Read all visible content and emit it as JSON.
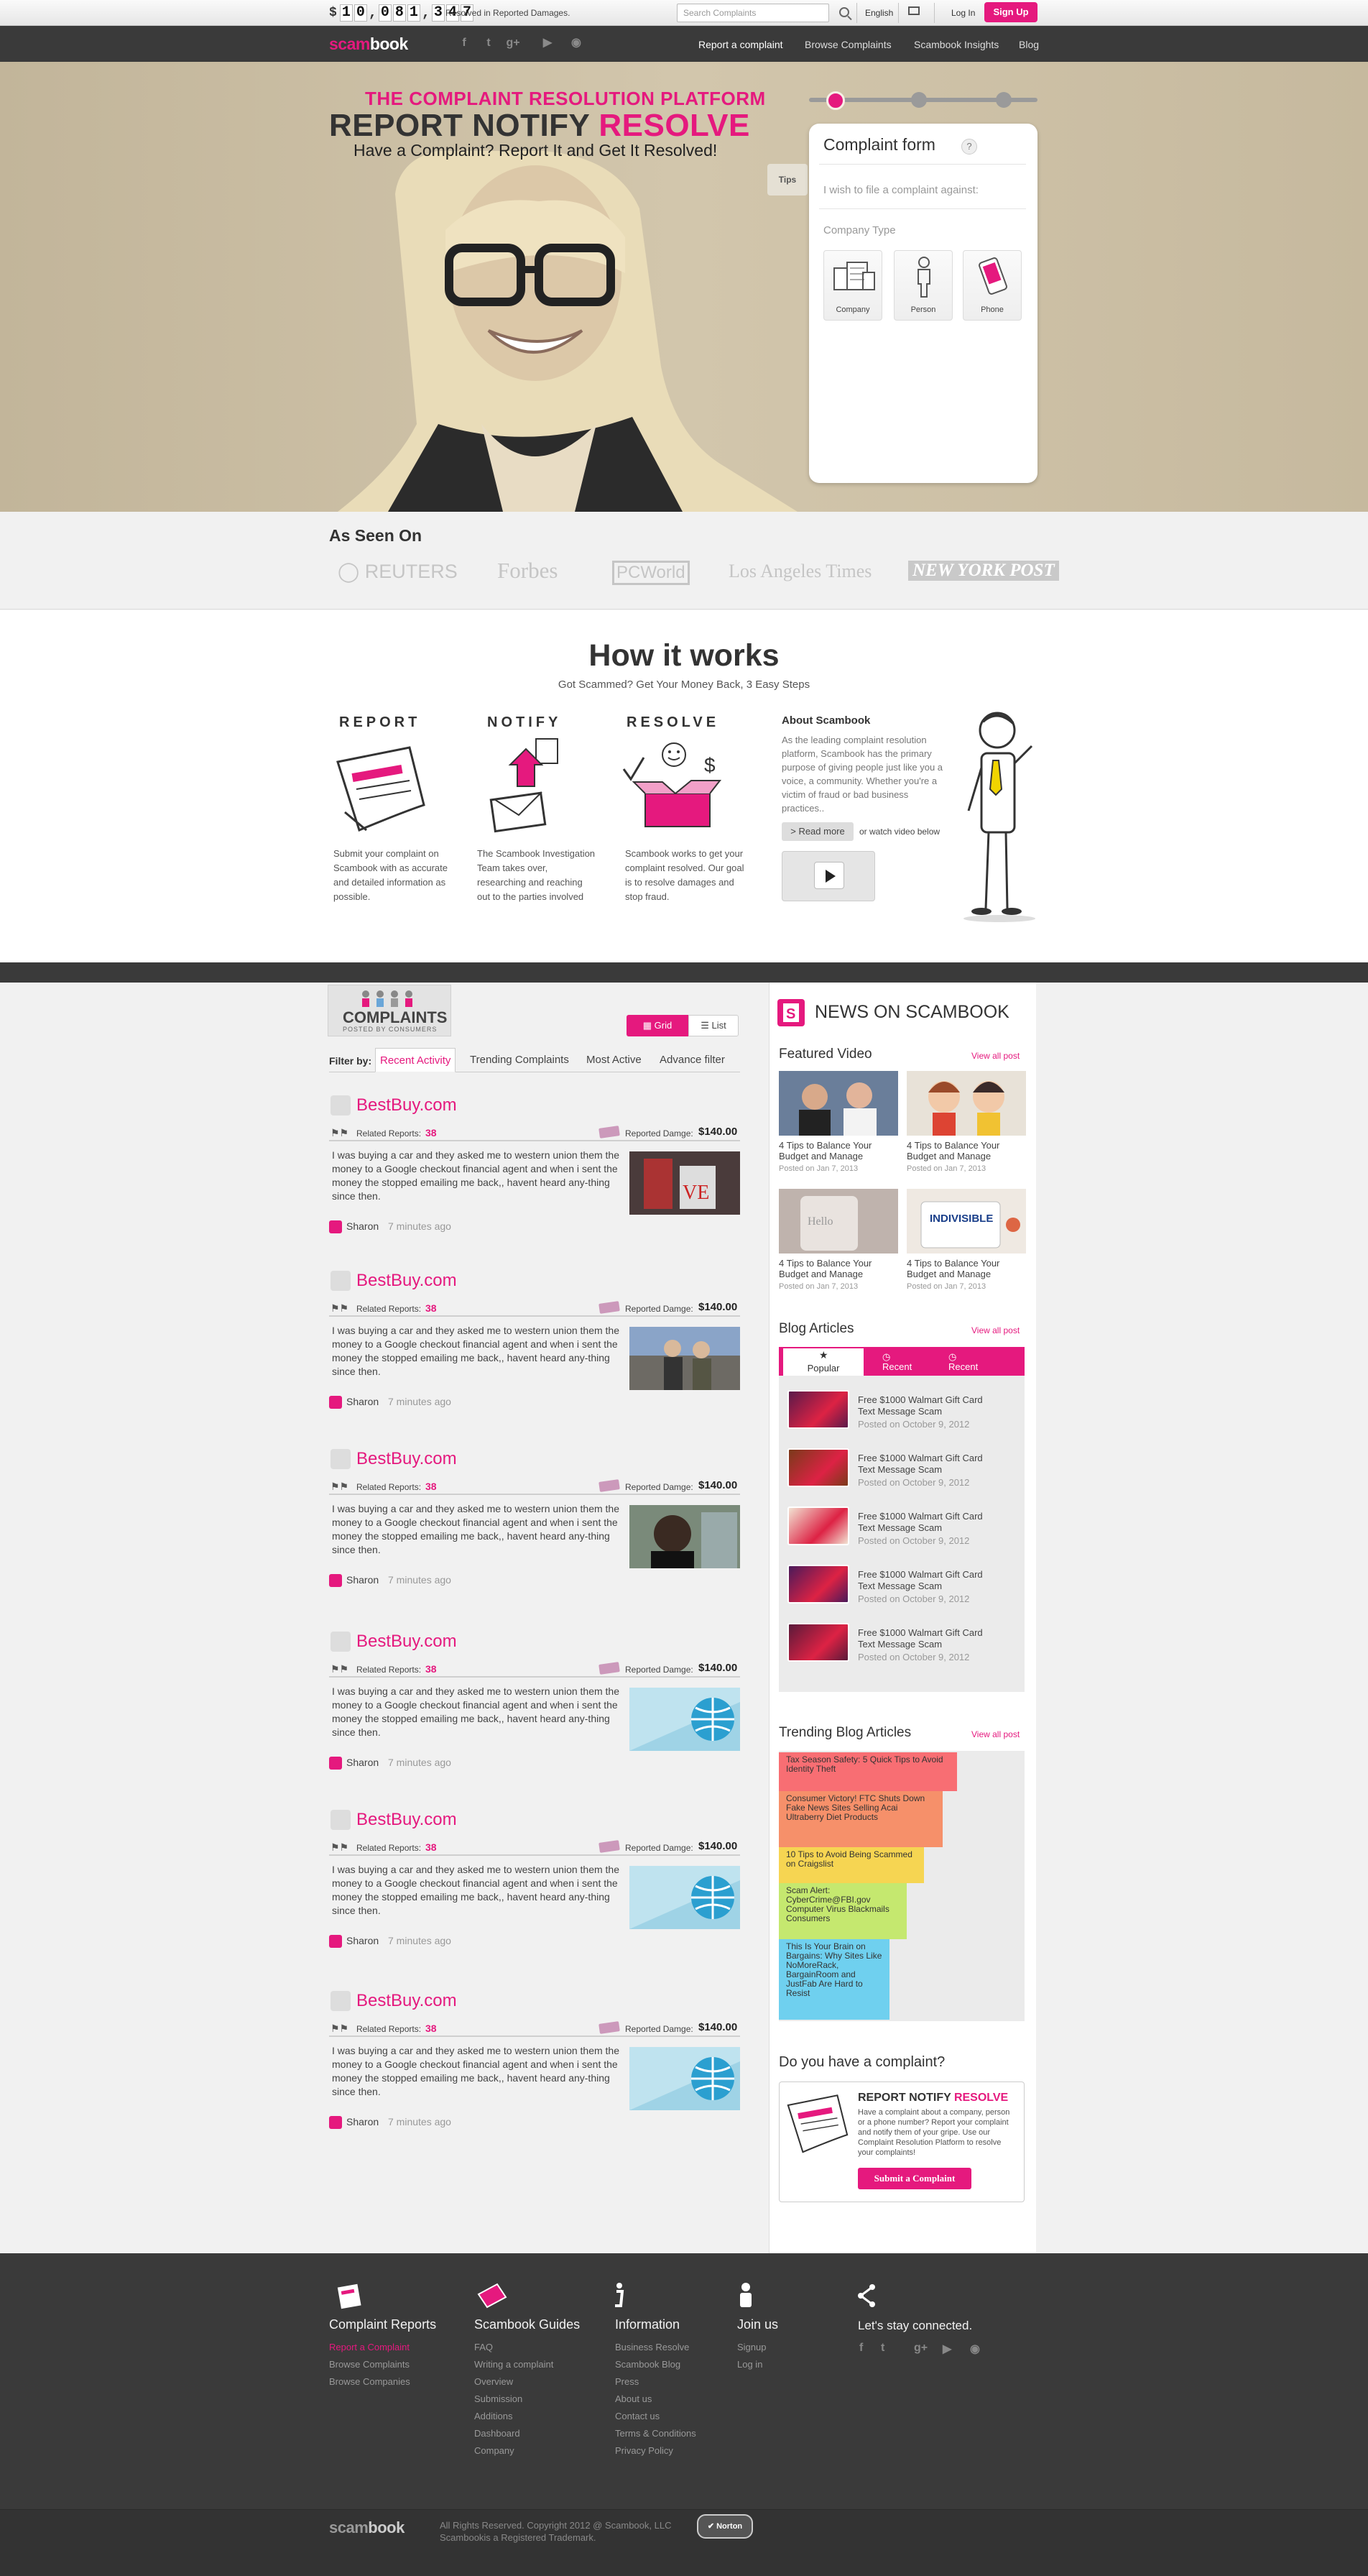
{
  "topbar": {
    "currency": "$",
    "counter": [
      "1",
      "0",
      ",",
      "0",
      "8",
      "1",
      ",",
      "3",
      "4",
      "7"
    ],
    "resolved_label": "Resolved in Reported Damages.",
    "search_placeholder": "Search Complaints",
    "language": "English",
    "login": "Log In",
    "signup": "Sign Up"
  },
  "logo": {
    "part1": "scam",
    "part2": "book"
  },
  "nav": {
    "links": [
      "Report a complaint",
      "Browse Complaints",
      "Scambook Insights",
      "Blog"
    ]
  },
  "hero": {
    "tagline": "THE COMPLAINT RESOLUTION PLATFORM",
    "headline": "REPORT NOTIFY",
    "headline_accent": "RESOLVE",
    "subline": "Have a Complaint? Report It and Get It Resolved!",
    "tips": "Tips",
    "form": {
      "title": "Complaint form",
      "help": "?",
      "prompt": "I wish to file a complaint against:",
      "type_label": "Company Type",
      "types": [
        "Company",
        "Person",
        "Phone"
      ]
    }
  },
  "as_seen_on": {
    "title": "As Seen On",
    "logos": [
      "REUTERS",
      "Forbes",
      "PCWorld",
      "Los Angeles Times",
      "NEW YORK POST"
    ]
  },
  "how": {
    "title": "How it works",
    "subtitle": "Got Scammed? Get Your Money Back, 3 Easy Steps",
    "steps": [
      {
        "title": "REPORT",
        "text": "Submit your complaint on Scambook with as accurate and detailed information as possible."
      },
      {
        "title": "NOTIFY",
        "text": "The Scambook Investigation Team takes over, researching and reaching out to the parties involved"
      },
      {
        "title": "RESOLVE",
        "text": "Scambook works to get your complaint resolved. Our goal is to resolve damages and stop fraud."
      }
    ],
    "about": {
      "title": "About Scambook",
      "text": "As the leading complaint resolution platform, Scambook has the primary purpose of giving people just like you a voice, a community. Whether you're a victim of fraud or bad business practices..",
      "read_more": "> Read more",
      "watch": "or watch video below"
    }
  },
  "complaints": {
    "badge_title": "COMPLAINTS",
    "badge_sub": "POSTED BY CONSUMERS",
    "grid": "Grid",
    "list": "List",
    "filter_label": "Filter by:",
    "filters": [
      "Recent Activity",
      "Trending Complaints",
      "Most Active",
      "Advance filter"
    ],
    "items": [
      {
        "title": "BestBuy.com",
        "related_label": "Related Reports:",
        "related": "38",
        "damage_label": "Reported Damge:",
        "damage": "$140.00",
        "text": "I was buying a car and they asked me to western union them the money to a Google checkout financial agent and when i sent the money the stopped emailing me back,, havent heard any-thing since then.",
        "user": "Sharon",
        "time": "7 minutes ago"
      },
      {
        "title": "BestBuy.com",
        "related_label": "Related Reports:",
        "related": "38",
        "damage_label": "Reported Damge:",
        "damage": "$140.00",
        "text": "I was buying a car and they asked me to western union them the money to a Google checkout financial agent and when i sent the money the stopped emailing me back,, havent heard any-thing since then.",
        "user": "Sharon",
        "time": "7 minutes ago"
      },
      {
        "title": "BestBuy.com",
        "related_label": "Related Reports:",
        "related": "38",
        "damage_label": "Reported Damge:",
        "damage": "$140.00",
        "text": "I was buying a car and they asked me to western union them the money to a Google checkout financial agent and when i sent the money the stopped emailing me back,, havent heard any-thing since then.",
        "user": "Sharon",
        "time": "7 minutes ago"
      },
      {
        "title": "BestBuy.com",
        "related_label": "Related Reports:",
        "related": "38",
        "damage_label": "Reported Damge:",
        "damage": "$140.00",
        "text": "I was buying a car and they asked me to western union them the money to a Google checkout financial agent and when i sent the money the stopped emailing me back,, havent heard any-thing since then.",
        "user": "Sharon",
        "time": "7 minutes ago"
      },
      {
        "title": "BestBuy.com",
        "related_label": "Related Reports:",
        "related": "38",
        "damage_label": "Reported Damge:",
        "damage": "$140.00",
        "text": "I was buying a car and they asked me to western union them the money to a Google checkout financial agent and when i sent the money the stopped emailing me back,, havent heard any-thing since then.",
        "user": "Sharon",
        "time": "7 minutes ago"
      },
      {
        "title": "BestBuy.com",
        "related_label": "Related Reports:",
        "related": "38",
        "damage_label": "Reported Damge:",
        "damage": "$140.00",
        "text": "I was buying a car and they asked me to western union them the money to a Google checkout financial agent and when i sent the money the stopped emailing me back,, havent heard any-thing since then.",
        "user": "Sharon",
        "time": "7 minutes ago"
      }
    ]
  },
  "news": {
    "title": "NEWS ON SCAMBOOK",
    "featured_title": "Featured Video",
    "view_all": "View all post",
    "videos": [
      {
        "title": "4 Tips to Balance Your Budget and Manage",
        "date": "Posted on Jan 7, 2013"
      },
      {
        "title": "4 Tips to Balance Your Budget and Manage",
        "date": "Posted on Jan 7, 2013"
      },
      {
        "title": "4 Tips to Balance Your Budget and Manage",
        "date": "Posted on Jan 7, 2013"
      },
      {
        "title": "4 Tips to Balance Your Budget and Manage",
        "date": "Posted on Jan 7, 2013"
      }
    ],
    "blog_title": "Blog Articles",
    "blog_tabs": [
      "Popular",
      "Recent",
      "Recent"
    ],
    "blog": [
      {
        "title": "Free $1000 Walmart Gift Card Text Message Scam",
        "date": "Posted on October 9, 2012"
      },
      {
        "title": "Free $1000 Walmart Gift Card Text Message Scam",
        "date": "Posted on October 9, 2012"
      },
      {
        "title": "Free $1000 Walmart Gift Card Text Message Scam",
        "date": "Posted on October 9, 2012"
      },
      {
        "title": "Free $1000 Walmart Gift Card Text Message Scam",
        "date": "Posted on October 9, 2012"
      },
      {
        "title": "Free $1000 Walmart Gift Card Text Message Scam",
        "date": "Posted on October 9, 2012"
      }
    ],
    "trending_title": "Trending Blog Articles",
    "trending": [
      {
        "title": "Tax Season Safety: 5 Quick Tips to Avoid Identity Theft",
        "color": "#f86e73"
      },
      {
        "title": "Consumer Victory! FTC Shuts Down Fake News Sites Selling Acai Ultraberry Diet Products",
        "color": "#f6906a"
      },
      {
        "title": "10 Tips to Avoid Being Scammed on Craigslist",
        "color": "#f6d552"
      },
      {
        "title": "Scam Alert: CyberCrime@FBI.gov Computer Virus Blackmails Consumers",
        "color": "#c5e86f"
      },
      {
        "title": "This Is Your Brain on Bargains: Why Sites Like NoMoreRack, BargainRoom and JustFab Are Hard to Resist",
        "color": "#6fd0ef"
      }
    ],
    "cta": {
      "title": "Do you have a complaint?",
      "heading": "REPORT NOTIFY",
      "heading_accent": "RESOLVE",
      "text": "Have a complaint about a company, person or a phone number? Report your complaint and notify them of your gripe. Use our Complaint Resolution Platform to resolve your complaints!",
      "button": "Submit a Complaint"
    }
  },
  "footer": {
    "cols": [
      {
        "title": "Complaint Reports",
        "links": [
          "Report a Complaint",
          "Browse Complaints",
          "Browse Companies"
        ]
      },
      {
        "title": "Scambook Guides",
        "links": [
          "FAQ",
          "Writing a complaint",
          "Overview",
          "Submission",
          "Additions",
          "Dashboard",
          "Company"
        ]
      },
      {
        "title": "Information",
        "links": [
          "Business Resolve",
          "Scambook Blog",
          "Press",
          "About us",
          "Contact us",
          "Terms & Conditions",
          "Privacy Policy"
        ]
      },
      {
        "title": "Join us",
        "links": [
          "Signup",
          "Log in"
        ]
      }
    ],
    "connect": "Let's stay connected.",
    "copyright1": "All Rights Reserved. Copyright 2012 @ Scambook, LLC",
    "copyright2": "Scambookis a Registered Trademark.",
    "norton": "Norton"
  },
  "colors": {
    "accent": "#e5197e",
    "dark": "#3a3a3a"
  }
}
